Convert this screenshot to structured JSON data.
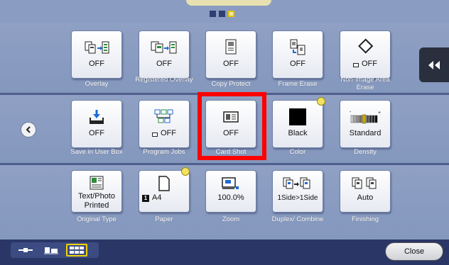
{
  "pager": {
    "pages": 3,
    "active_index": 2
  },
  "rows": [
    [
      {
        "key": "overlay",
        "value": "OFF",
        "caption": "Overlay",
        "icon": "overlay-icon"
      },
      {
        "key": "registered-overlay",
        "value": "OFF",
        "caption": "Registered Overlay",
        "icon": "registered-overlay-icon"
      },
      {
        "key": "copy-protect",
        "value": "OFF",
        "caption": "Copy Protect",
        "icon": "copy-protect-icon"
      },
      {
        "key": "frame-erase",
        "value": "OFF",
        "caption": "Frame Erase",
        "icon": "frame-erase-icon"
      },
      {
        "key": "non-image-area-erase",
        "value": "OFF",
        "caption": "Non-Image Area Erase",
        "icon": "non-image-erase-icon"
      }
    ],
    [
      {
        "key": "save-in-user-box",
        "value": "OFF",
        "caption": "Save in User Box",
        "icon": "save-box-icon"
      },
      {
        "key": "program-jobs",
        "value": "OFF",
        "caption": "Program Jobs",
        "icon": "program-jobs-icon"
      },
      {
        "key": "card-shot",
        "value": "OFF",
        "caption": "Card Shot",
        "icon": "card-shot-icon"
      },
      {
        "key": "color",
        "value": "Black",
        "caption": "Color",
        "icon": "color-swatch-icon"
      },
      {
        "key": "density",
        "value": "Standard",
        "caption": "Density",
        "icon": "density-scale-icon"
      }
    ],
    [
      {
        "key": "original-type",
        "value": "Text/Photo Printed",
        "caption": "Original Type",
        "icon": "original-type-icon"
      },
      {
        "key": "paper",
        "value": "A4",
        "value_prefix": "1",
        "caption": "Paper",
        "icon": "paper-icon"
      },
      {
        "key": "zoom",
        "value": "100.0%",
        "caption": "Zoom",
        "icon": "zoom-icon"
      },
      {
        "key": "duplex-combine",
        "value": "1Side>1Side",
        "caption": "Duplex/ Combine",
        "icon": "duplex-icon"
      },
      {
        "key": "finishing",
        "value": "Auto",
        "caption": "Finishing",
        "icon": "finishing-icon"
      }
    ]
  ],
  "controls": {
    "close_label": "Close",
    "collapse_icon": "double-chevron-left-icon",
    "back_icon": "chevron-left-icon"
  },
  "colors": {
    "highlight": "#ff0000",
    "background": "#8a9cc1",
    "status_dot": "#f2e264"
  }
}
